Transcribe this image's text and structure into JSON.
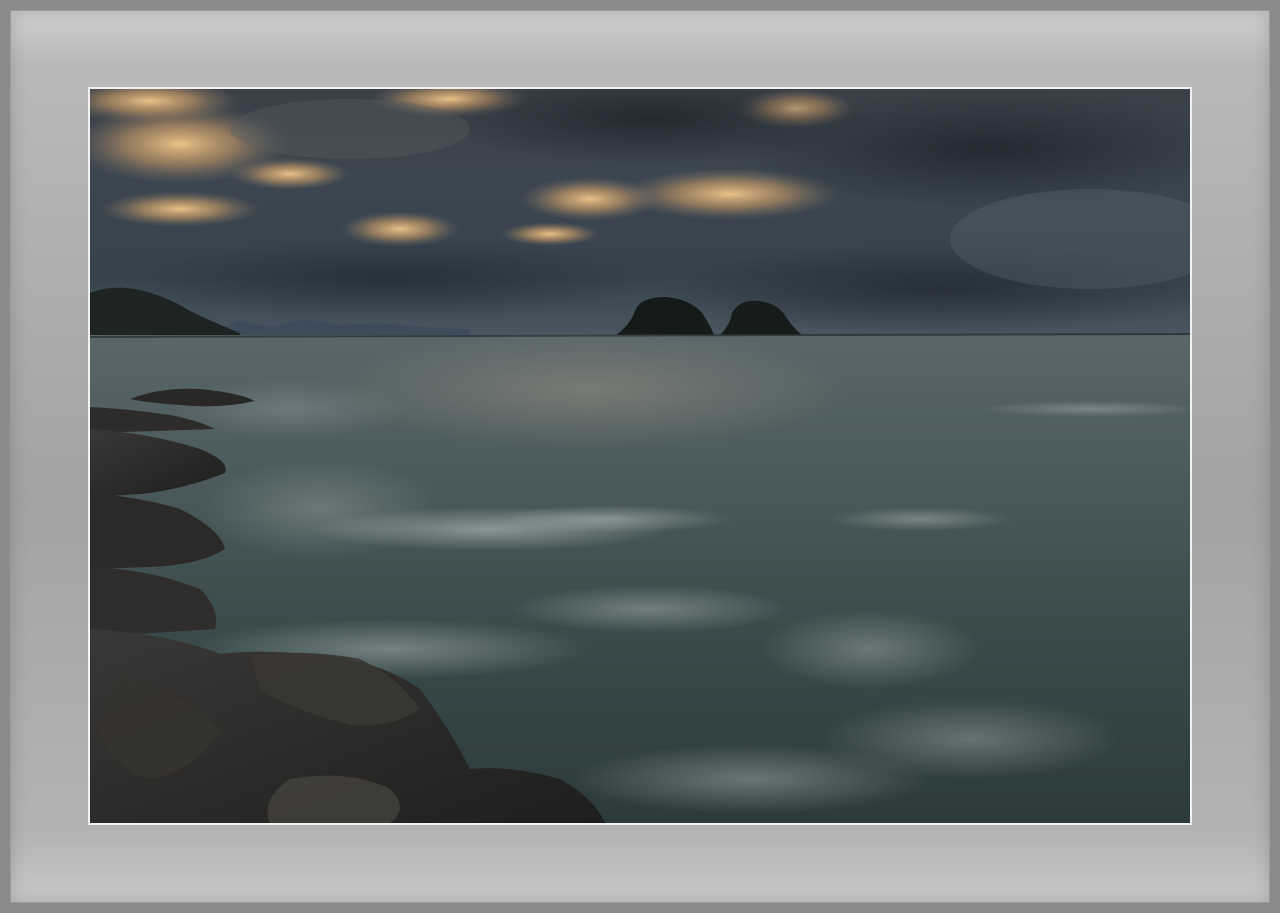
{
  "scene": {
    "subject": "seascape-at-dusk",
    "colors": {
      "frame": "#8a8a8a",
      "mat_light": "#cfcfcf",
      "mat_mid": "#a5a5a5",
      "photo_border": "#f2f2f2",
      "sky_dark": "#2c3640",
      "cloud_glow": "#e8b878",
      "sea": "#3a4a4c",
      "rocks": "#2b2b2b"
    }
  }
}
